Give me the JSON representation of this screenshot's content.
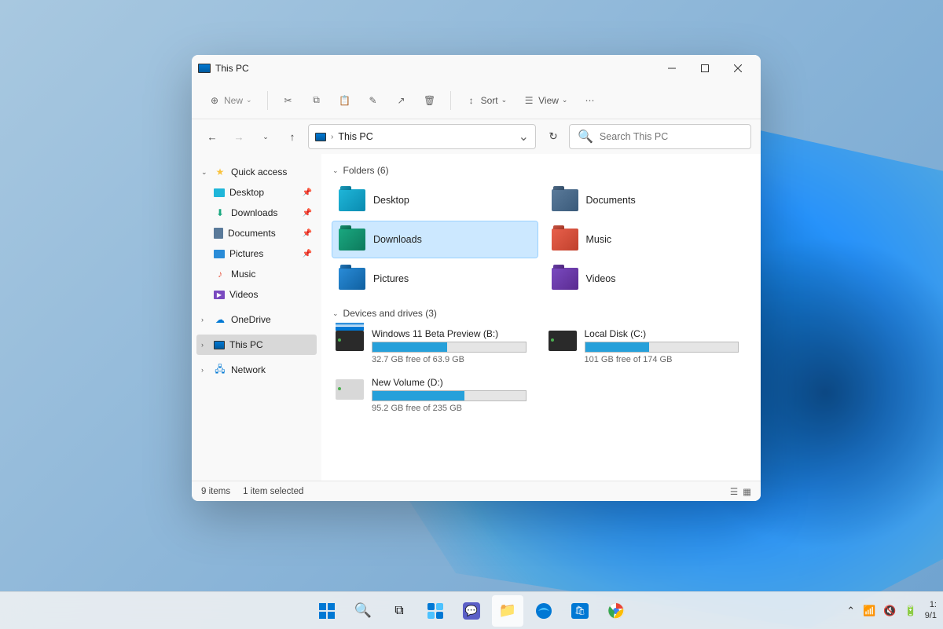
{
  "window": {
    "title": "This PC",
    "toolbar": {
      "new_label": "New",
      "sort_label": "Sort",
      "view_label": "View"
    },
    "address": {
      "crumb": "This PC"
    },
    "search": {
      "placeholder": "Search This PC"
    },
    "status": {
      "items": "9 items",
      "selected": "1 item selected"
    }
  },
  "sidebar": {
    "quick_access": "Quick access",
    "qa_items": [
      {
        "label": "Desktop"
      },
      {
        "label": "Downloads"
      },
      {
        "label": "Documents"
      },
      {
        "label": "Pictures"
      },
      {
        "label": "Music"
      },
      {
        "label": "Videos"
      }
    ],
    "onedrive": "OneDrive",
    "this_pc": "This PC",
    "network": "Network"
  },
  "main": {
    "folders_header": "Folders (6)",
    "folders": [
      {
        "label": "Desktop"
      },
      {
        "label": "Documents"
      },
      {
        "label": "Downloads"
      },
      {
        "label": "Music"
      },
      {
        "label": "Pictures"
      },
      {
        "label": "Videos"
      }
    ],
    "drives_header": "Devices and drives (3)",
    "drives": [
      {
        "name": "Windows 11 Beta Preview (B:)",
        "free": "32.7 GB free of 63.9 GB",
        "fill_pct": 49
      },
      {
        "name": "Local Disk (C:)",
        "free": "101 GB free of 174 GB",
        "fill_pct": 42
      },
      {
        "name": "New Volume (D:)",
        "free": "95.2 GB free of 235 GB",
        "fill_pct": 60
      }
    ]
  },
  "tray": {
    "time": "1:",
    "date": "9/1"
  }
}
